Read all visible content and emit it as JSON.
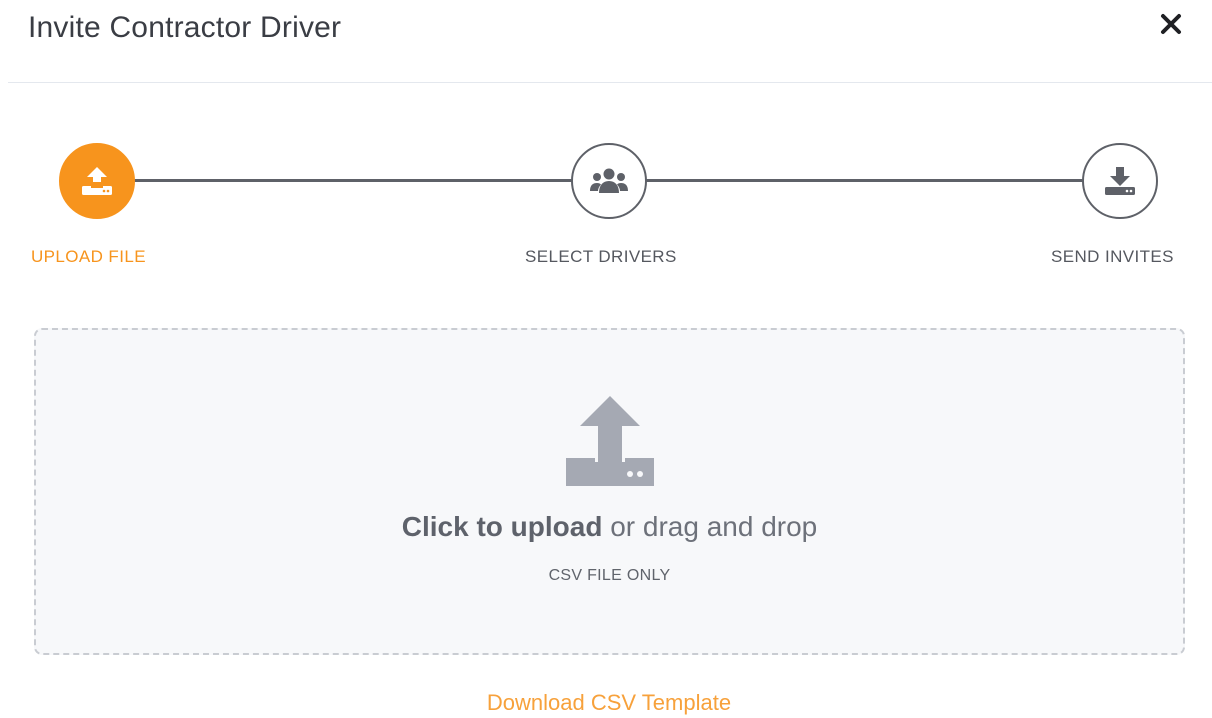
{
  "modal": {
    "title": "Invite Contractor Driver",
    "close_icon": "close-icon"
  },
  "stepper": {
    "steps": [
      {
        "label": "UPLOAD FILE",
        "icon": "upload-icon",
        "state": "active"
      },
      {
        "label": "SELECT DRIVERS",
        "icon": "users-icon",
        "state": "inactive"
      },
      {
        "label": "SEND INVITES",
        "icon": "download-icon",
        "state": "inactive"
      }
    ]
  },
  "upload": {
    "icon": "upload-tray-icon",
    "cta_strong": "Click to upload",
    "cta_rest": " or drag and drop",
    "hint": "CSV FILE ONLY"
  },
  "download_template_label": "Download CSV Template",
  "colors": {
    "accent": "#f7941d",
    "step_inactive": "#5e6168",
    "dropzone_bg": "#f7f8fa",
    "dropzone_border": "#c9ccd2",
    "icon_gray": "#a5a9b3"
  }
}
